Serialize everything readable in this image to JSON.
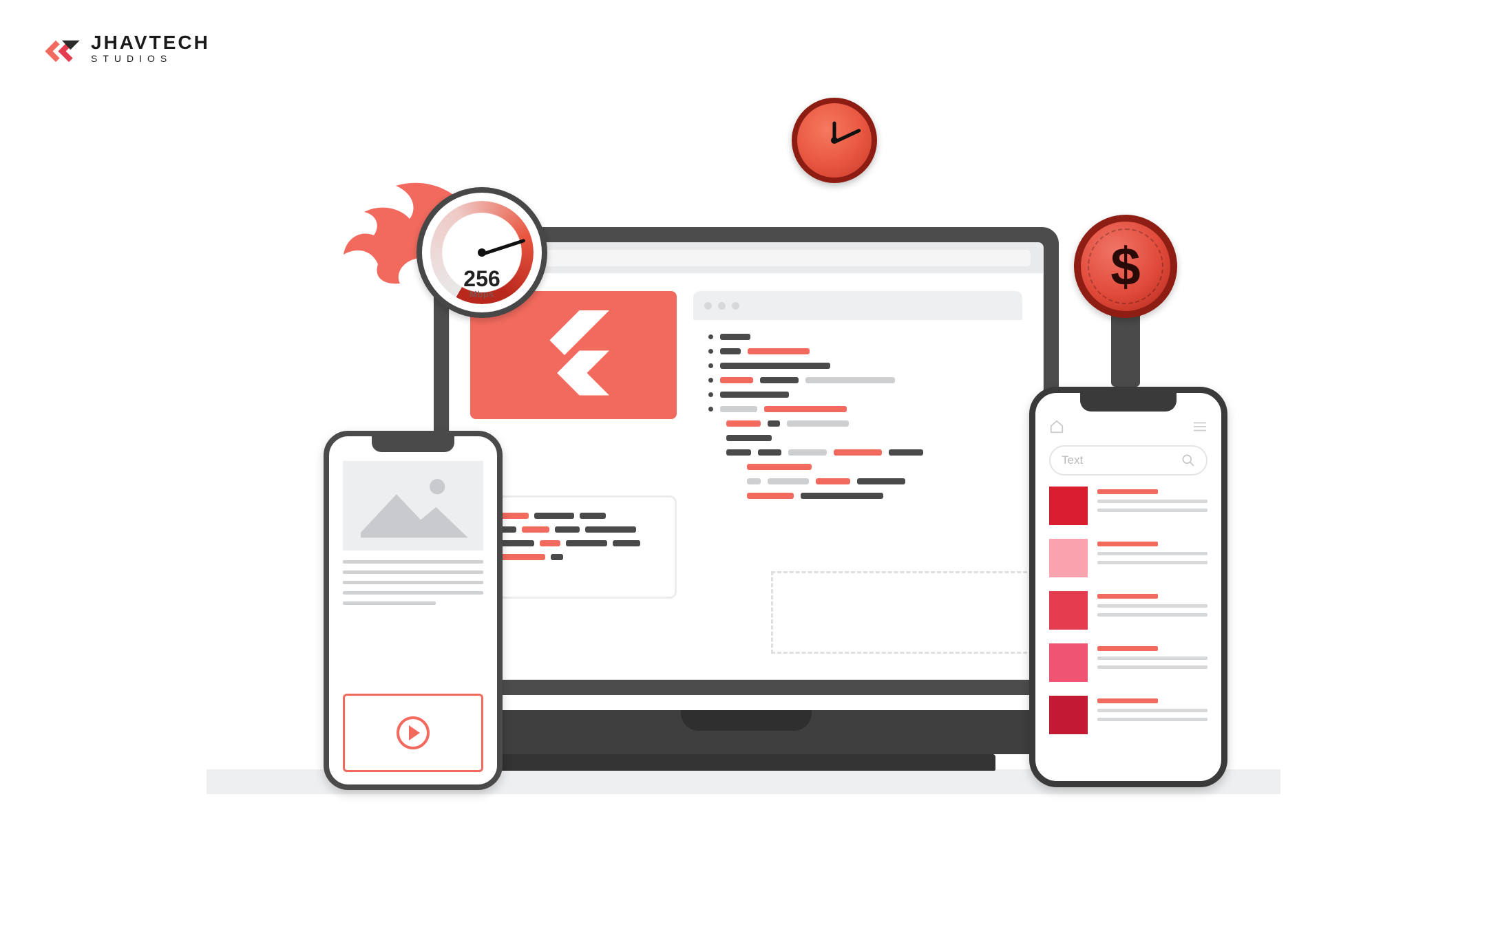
{
  "brand": {
    "name": "JHAVTECH",
    "sub": "STUDIOS"
  },
  "gauge": {
    "value": "256",
    "unit": "Mbps"
  },
  "coin": {
    "symbol": "$"
  },
  "right_phone": {
    "search_placeholder": "Text"
  },
  "colors": {
    "accent": "#f26a5e",
    "dark": "#4a4a4a",
    "swatches": [
      "#d81e2e",
      "#f8a3ad",
      "#e43d50",
      "#ef5573",
      "#c21a35"
    ]
  }
}
